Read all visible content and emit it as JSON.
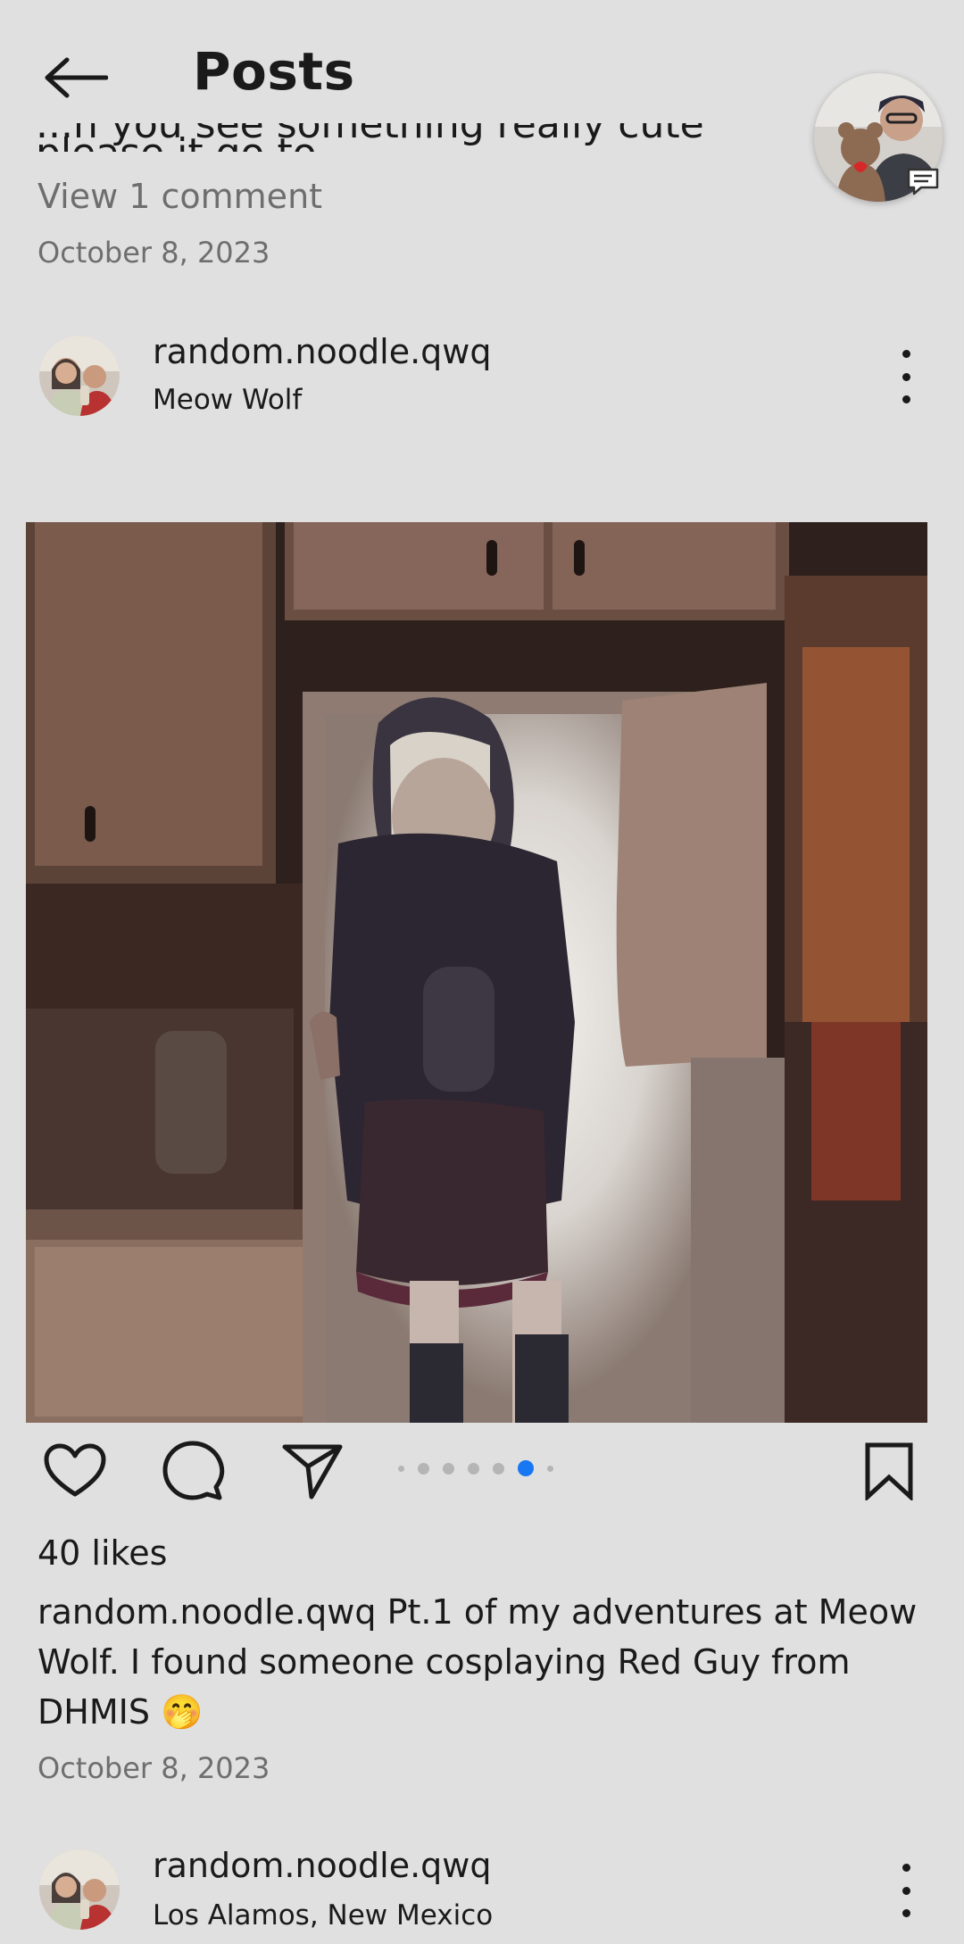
{
  "header": {
    "title": "Posts",
    "back_icon": "arrow-left-icon"
  },
  "previous_post": {
    "caption_cutoff": "...n you see something really cute please it go to...",
    "view_comments": "View 1 comment",
    "date": "October 8, 2023"
  },
  "post": {
    "username": "random.noodle.qwq",
    "location": "Meow Wolf",
    "likes": "40 likes",
    "caption_username": "random.noodle.qwq",
    "caption_text": " Pt.1 of my adventures at Meow Wolf. I found someone cosplaying Red Guy from DHMIS 🤭",
    "date": "October 8, 2023",
    "carousel": {
      "count": 7,
      "active_index": 5
    },
    "colors": {
      "active_dot": "#1877f2",
      "inactive_dot": "#b5b5b5"
    }
  },
  "next_post": {
    "username": "random.noodle.qwq",
    "location": "Los Alamos, New Mexico"
  }
}
